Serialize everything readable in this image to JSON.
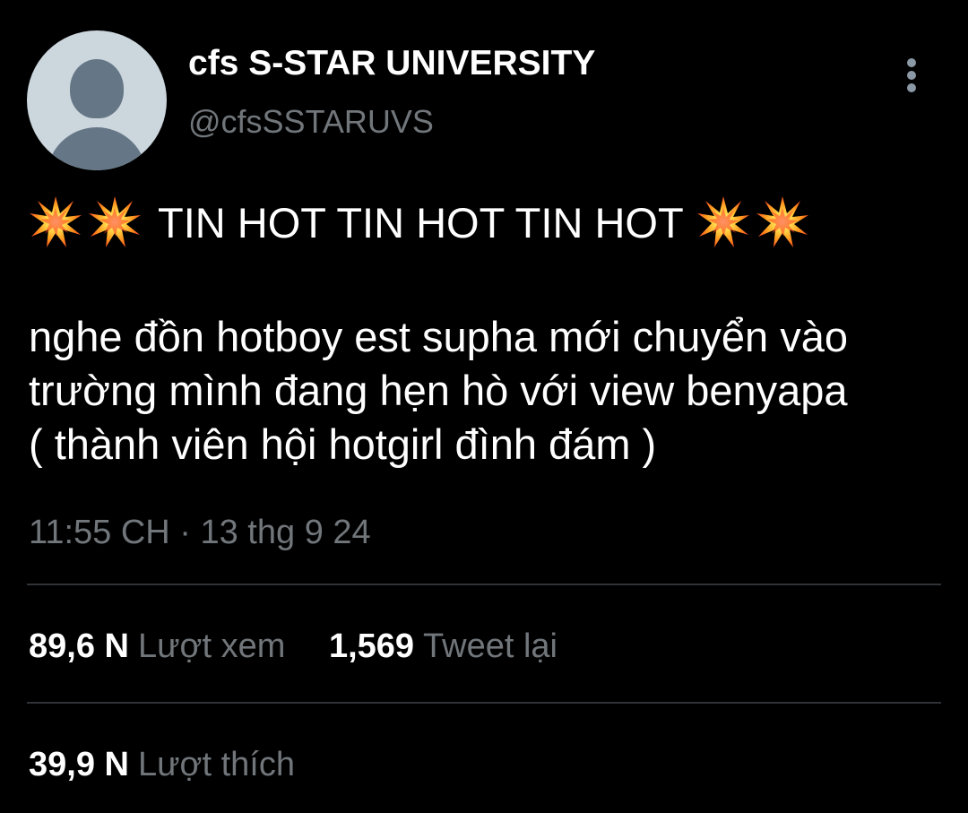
{
  "author": {
    "display_name": "cfs S-STAR UNIVERSITY",
    "handle": "@cfsSSTARUVS",
    "avatar_icon": "default-profile-icon"
  },
  "menu": {
    "icon": "more-options-icon"
  },
  "tweet": {
    "headline_text": "TIN HOT TIN HOT TIN HOT",
    "headline_emoji": "collision-emoji",
    "lines": [
      "nghe đồn hotboy est supha mới chuyển vào",
      "trường mình đang hẹn hò với view benyapa",
      "( thành viên hội hotgirl đình đám )"
    ],
    "timestamp": "11:55 CH · 13 thg 9 24"
  },
  "stats": {
    "views_count": "89,6 N",
    "views_label": "Lượt xem",
    "retweets_count": "1,569",
    "retweets_label": "Tweet lại",
    "likes_count": "39,9 N",
    "likes_label": "Lượt thích"
  },
  "colors": {
    "background": "#000000",
    "primary_text": "#ffffff",
    "secondary_text": "#71767b",
    "divider": "#2f3336",
    "avatar_bg": "#ccd6dd",
    "avatar_fg": "#657786"
  }
}
